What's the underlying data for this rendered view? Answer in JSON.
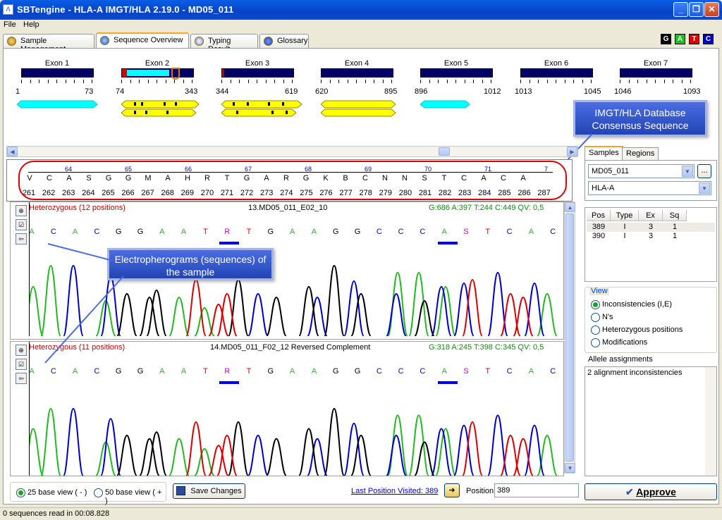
{
  "window": {
    "title": "SBTengine - HLA-A IMGT/HLA 2.19.0 - MD05_011"
  },
  "menu": [
    "File",
    "Help"
  ],
  "tabs": [
    "Sample Management",
    "Sequence Overview",
    "Typing Result",
    "Glossary"
  ],
  "gatc": [
    {
      "l": "G",
      "c": "#000000"
    },
    {
      "l": "A",
      "c": "#22bb22"
    },
    {
      "l": "T",
      "c": "#dd0000"
    },
    {
      "l": "C",
      "c": "#0000cc"
    }
  ],
  "exons": [
    {
      "label": "Exon 1",
      "start": "1",
      "end": "73"
    },
    {
      "label": "Exon 2",
      "start": "74",
      "end": "343"
    },
    {
      "label": "Exon 3",
      "start": "344",
      "end": "619"
    },
    {
      "label": "Exon 4",
      "start": "620",
      "end": "895"
    },
    {
      "label": "Exon 5",
      "start": "896",
      "end": "1012"
    },
    {
      "label": "Exon 6",
      "start": "1013",
      "end": "1045"
    },
    {
      "label": "Exon 7",
      "start": "1046",
      "end": "1093"
    }
  ],
  "callouts": {
    "imgt": "IMGT/HLA Database Consensus Sequence",
    "electro": "Electropherograms (sequences) of the sample"
  },
  "consensus": {
    "codons": [
      "64",
      "65",
      "66",
      "67",
      "68",
      "69",
      "70",
      "71",
      "7"
    ],
    "aa": [
      "V",
      "C",
      "A",
      "S",
      "G",
      "G",
      "M",
      "A",
      "H",
      "R",
      "T",
      "G",
      "A",
      "R",
      "G",
      "K",
      "B",
      "C",
      "N",
      "N",
      "S",
      "T",
      "C",
      "A",
      "C",
      "A"
    ],
    "positions": [
      "261",
      "262",
      "263",
      "264",
      "265",
      "266",
      "267",
      "268",
      "269",
      "270",
      "271",
      "272",
      "273",
      "274",
      "275",
      "276",
      "277",
      "278",
      "279",
      "280",
      "281",
      "282",
      "283",
      "284",
      "285",
      "286",
      "287"
    ]
  },
  "traces": [
    {
      "hetero": "Heterozygous (12 positions)",
      "name": "13.MD05_011_E02_10",
      "stats": "G:686 A:397 T:244 C:449 QV: 0,5",
      "bases": [
        "A",
        "C",
        "A",
        "C",
        "G",
        "G",
        "A",
        "A",
        "T",
        "R",
        "T",
        "G",
        "A",
        "A",
        "G",
        "G",
        "C",
        "C",
        "C",
        "A",
        "S",
        "T",
        "C",
        "A",
        "C"
      ]
    },
    {
      "hetero": "Heterozygous (11 positions)",
      "name": "14.MD05_011_F02_12 Reversed Complement",
      "stats": "G:318 A:245 T:398 C:345 QV: 0,5",
      "bases": [
        "A",
        "C",
        "A",
        "C",
        "G",
        "G",
        "A",
        "A",
        "T",
        "R",
        "T",
        "G",
        "A",
        "A",
        "G",
        "G",
        "C",
        "C",
        "C",
        "A",
        "S",
        "T",
        "C",
        "A",
        "C"
      ]
    }
  ],
  "right": {
    "tabs": [
      "Samples",
      "Regions"
    ],
    "sample": "MD05_011",
    "locus": "HLA-A",
    "table_headers": [
      "Pos",
      "Type",
      "Ex",
      "Sq"
    ],
    "rows": [
      [
        "389",
        "I",
        "3",
        "1"
      ],
      [
        "390",
        "I",
        "3",
        "1"
      ]
    ],
    "view_title": "View",
    "view_options": [
      "Inconsistencies (I,E)",
      "N's",
      "Heterozygous positions",
      "Modifications"
    ],
    "allele_title": "Allele assignments",
    "allele_text": "2 alignment inconsistencies"
  },
  "bottom": {
    "view25": "25 base view ( - )",
    "view50": "50 base view ( + )",
    "save": "Save Changes",
    "last_pos": "Last Position Visited: 389",
    "position_label": "Position",
    "position_value": "389",
    "approve": "Approve"
  },
  "status": "0 sequences read in 00:08.828"
}
